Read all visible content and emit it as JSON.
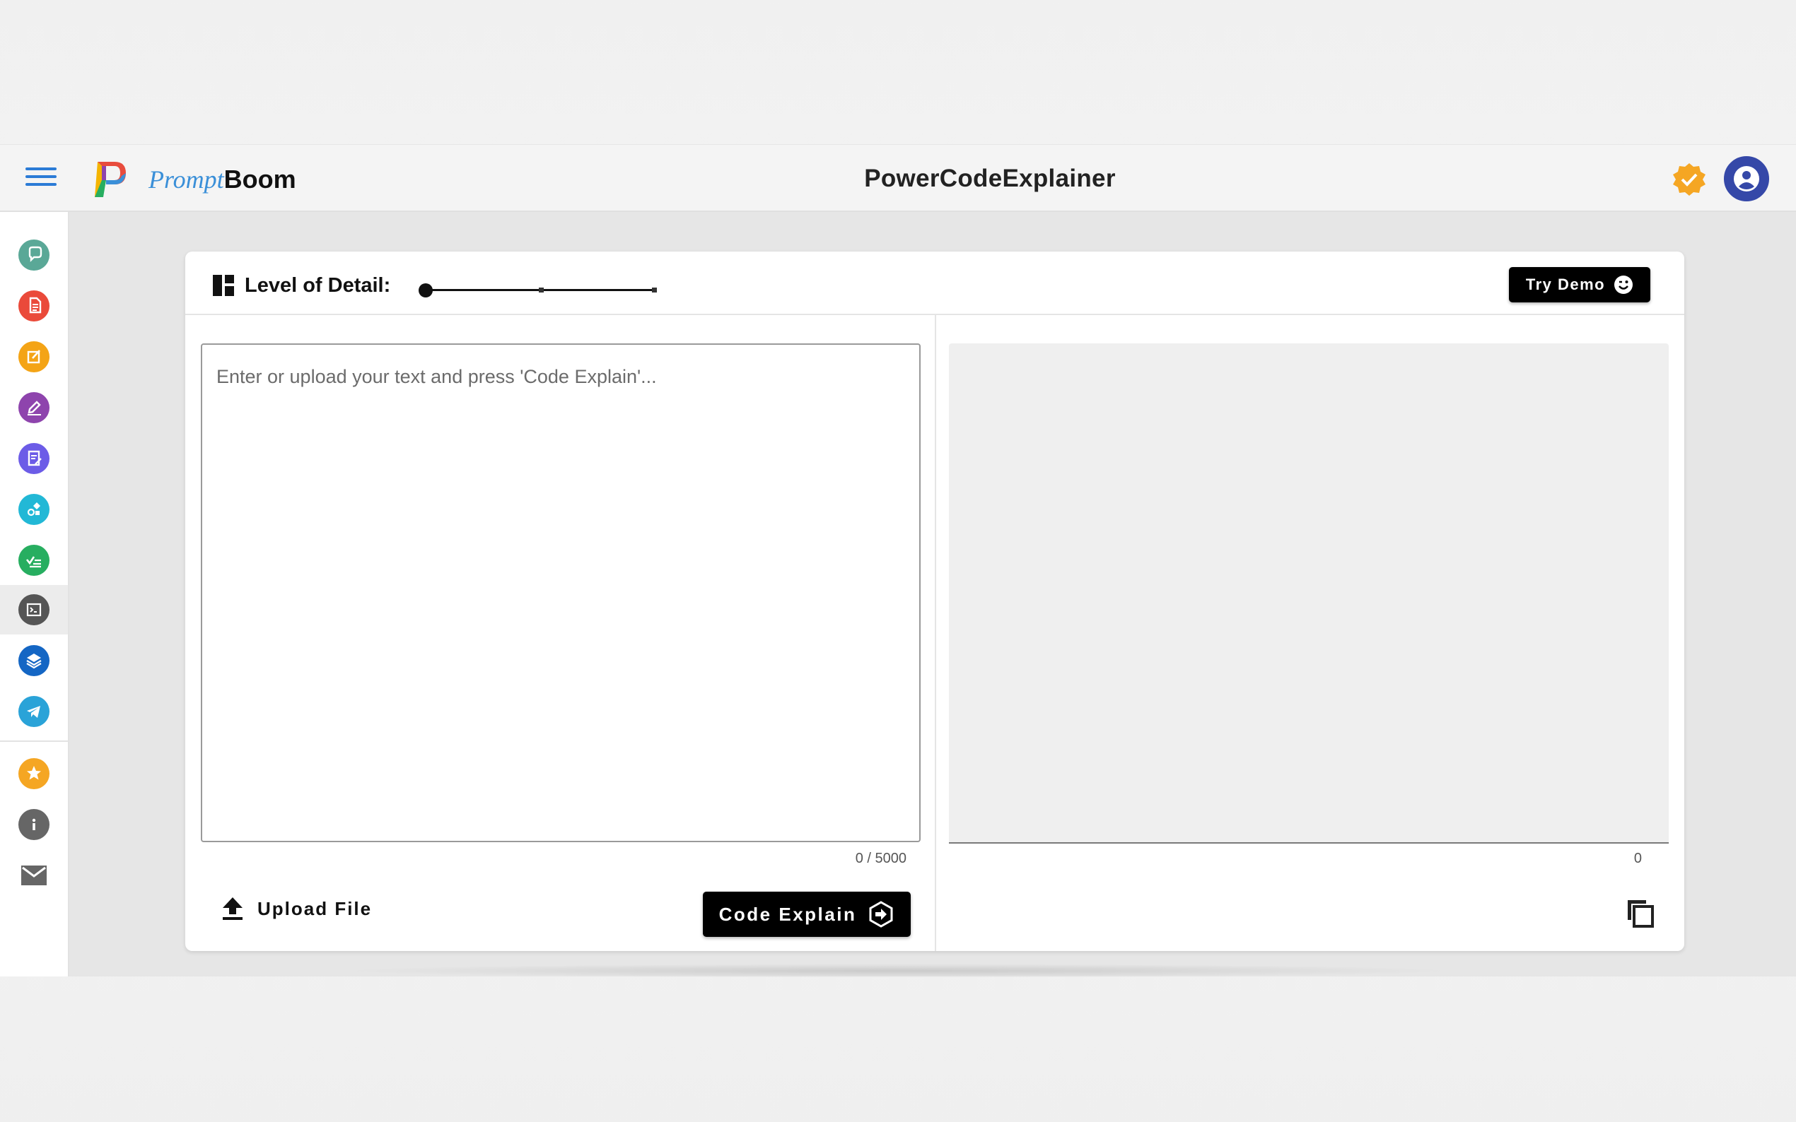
{
  "header": {
    "brand_prompt": "Prompt",
    "brand_boom": "Boom",
    "title": "PowerCodeExplainer"
  },
  "sidebar": {
    "items": [
      {
        "icon": "chat-icon",
        "color": "#5aa897"
      },
      {
        "icon": "document-icon",
        "color": "#ea4a3a"
      },
      {
        "icon": "edit-box-icon",
        "color": "#f4a416"
      },
      {
        "icon": "pen-icon",
        "color": "#8e44ad"
      },
      {
        "icon": "notes-icon",
        "color": "#6c5ce7"
      },
      {
        "icon": "shapes-icon",
        "color": "#22b8d6"
      },
      {
        "icon": "checklist-icon",
        "color": "#27ae60"
      },
      {
        "icon": "terminal-icon",
        "color": "#555555",
        "active": true
      },
      {
        "icon": "layers-icon",
        "color": "#1466c4"
      },
      {
        "icon": "telegram-icon",
        "color": "#2aa3d8"
      },
      {
        "icon": "star-icon",
        "color": "#f5a623"
      },
      {
        "icon": "info-icon",
        "color": "#666666"
      },
      {
        "icon": "mail-icon",
        "color": "#666666"
      }
    ]
  },
  "controls": {
    "detail_label": "Level of Detail:",
    "detail_level": 0,
    "try_demo": "Try Demo"
  },
  "input": {
    "placeholder": "Enter or upload your text and press 'Code Explain'...",
    "counter": "0 / 5000",
    "upload_label": "Upload File",
    "explain_label": "Code Explain"
  },
  "output": {
    "counter": "0"
  },
  "colors": {
    "accent": "#2b7bd6",
    "badge": "#f5a623",
    "avatar": "#3548a8"
  }
}
